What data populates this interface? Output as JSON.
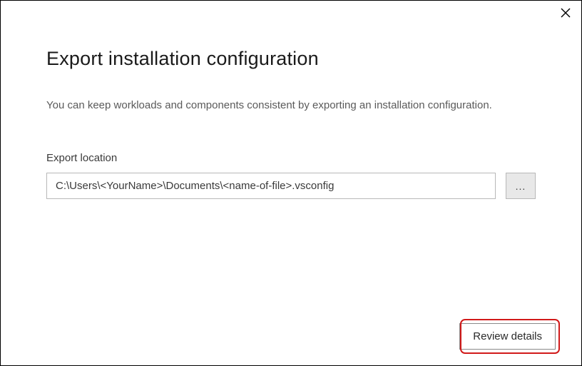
{
  "dialog": {
    "title": "Export installation configuration",
    "description": "You can keep workloads and components consistent by exporting an installation configuration.",
    "fieldLabel": "Export location",
    "pathValue": "C:\\Users\\<YourName>\\Documents\\<name-of-file>.vsconfig",
    "browseLabel": "...",
    "reviewLabel": "Review details"
  }
}
